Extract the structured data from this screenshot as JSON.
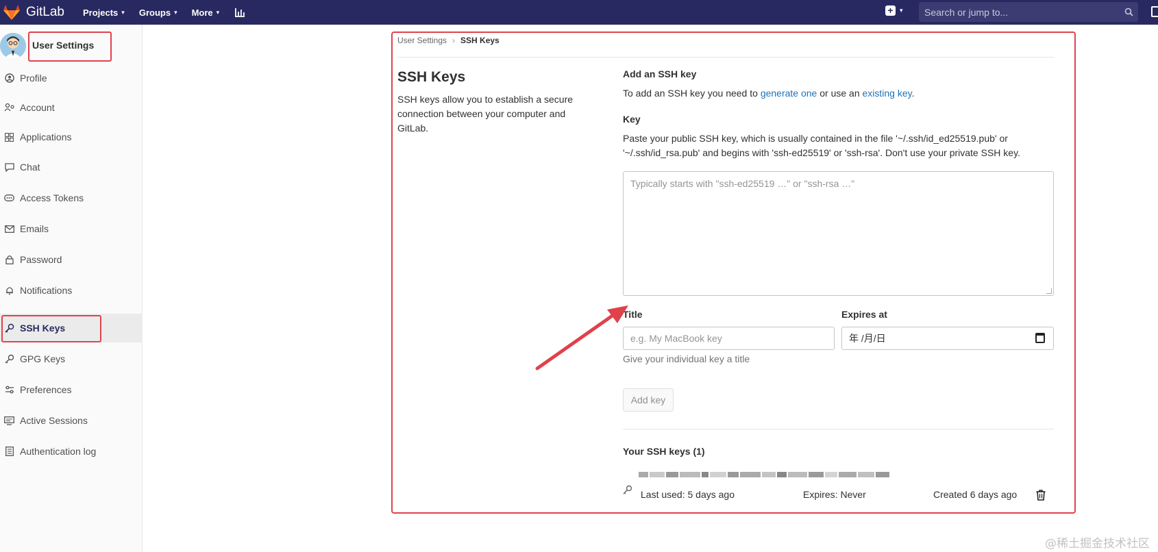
{
  "topbar": {
    "brand": "GitLab",
    "nav": [
      {
        "label": "Projects"
      },
      {
        "label": "Groups"
      },
      {
        "label": "More"
      }
    ],
    "search_placeholder": "Search or jump to...",
    "bg_color": "#292961"
  },
  "sidebar": {
    "title": "User Settings",
    "items": [
      {
        "label": "Profile",
        "icon": "profile-icon"
      },
      {
        "label": "Account",
        "icon": "account-icon"
      },
      {
        "label": "Applications",
        "icon": "applications-icon"
      },
      {
        "label": "Chat",
        "icon": "chat-icon"
      },
      {
        "label": "Access Tokens",
        "icon": "token-icon"
      },
      {
        "label": "Emails",
        "icon": "mail-icon"
      },
      {
        "label": "Password",
        "icon": "lock-icon"
      },
      {
        "label": "Notifications",
        "icon": "bell-icon"
      },
      {
        "label": "SSH Keys",
        "icon": "key-icon",
        "active": true
      },
      {
        "label": "GPG Keys",
        "icon": "key-icon"
      },
      {
        "label": "Preferences",
        "icon": "preferences-icon"
      },
      {
        "label": "Active Sessions",
        "icon": "monitor-icon"
      },
      {
        "label": "Authentication log",
        "icon": "log-icon"
      }
    ]
  },
  "breadcrumb": {
    "parent": "User Settings",
    "current": "SSH Keys"
  },
  "page": {
    "title": "SSH Keys",
    "description": "SSH keys allow you to establish a secure connection between your computer and GitLab."
  },
  "add_key": {
    "heading": "Add an SSH key",
    "intro_prefix": "To add an SSH key you need to ",
    "intro_link1": "generate one",
    "intro_mid": " or use an ",
    "intro_link2": "existing key",
    "intro_suffix": ".",
    "key_label": "Key",
    "key_help_line1": "Paste your public SSH key, which is usually contained in the file '~/.ssh/id_ed25519.pub' or",
    "key_help_line2": "'~/.ssh/id_rsa.pub' and begins with 'ssh-ed25519' or 'ssh-rsa'. Don't use your private SSH key.",
    "key_placeholder": "Typically starts with \"ssh-ed25519 …\" or \"ssh-rsa …\"",
    "title_label": "Title",
    "title_placeholder": "e.g. My MacBook key",
    "title_help": "Give your individual key a title",
    "expires_label": "Expires at",
    "expires_value": "年 /月/日",
    "submit_label": "Add key"
  },
  "your_keys": {
    "heading": "Your SSH keys (1)",
    "items": [
      {
        "last_used": "Last used: 5 days ago",
        "expires": "Expires: Never",
        "created": "Created 6 days ago"
      }
    ]
  },
  "watermark": "@稀土掘金技术社区",
  "annotation_color": "#e0424a"
}
